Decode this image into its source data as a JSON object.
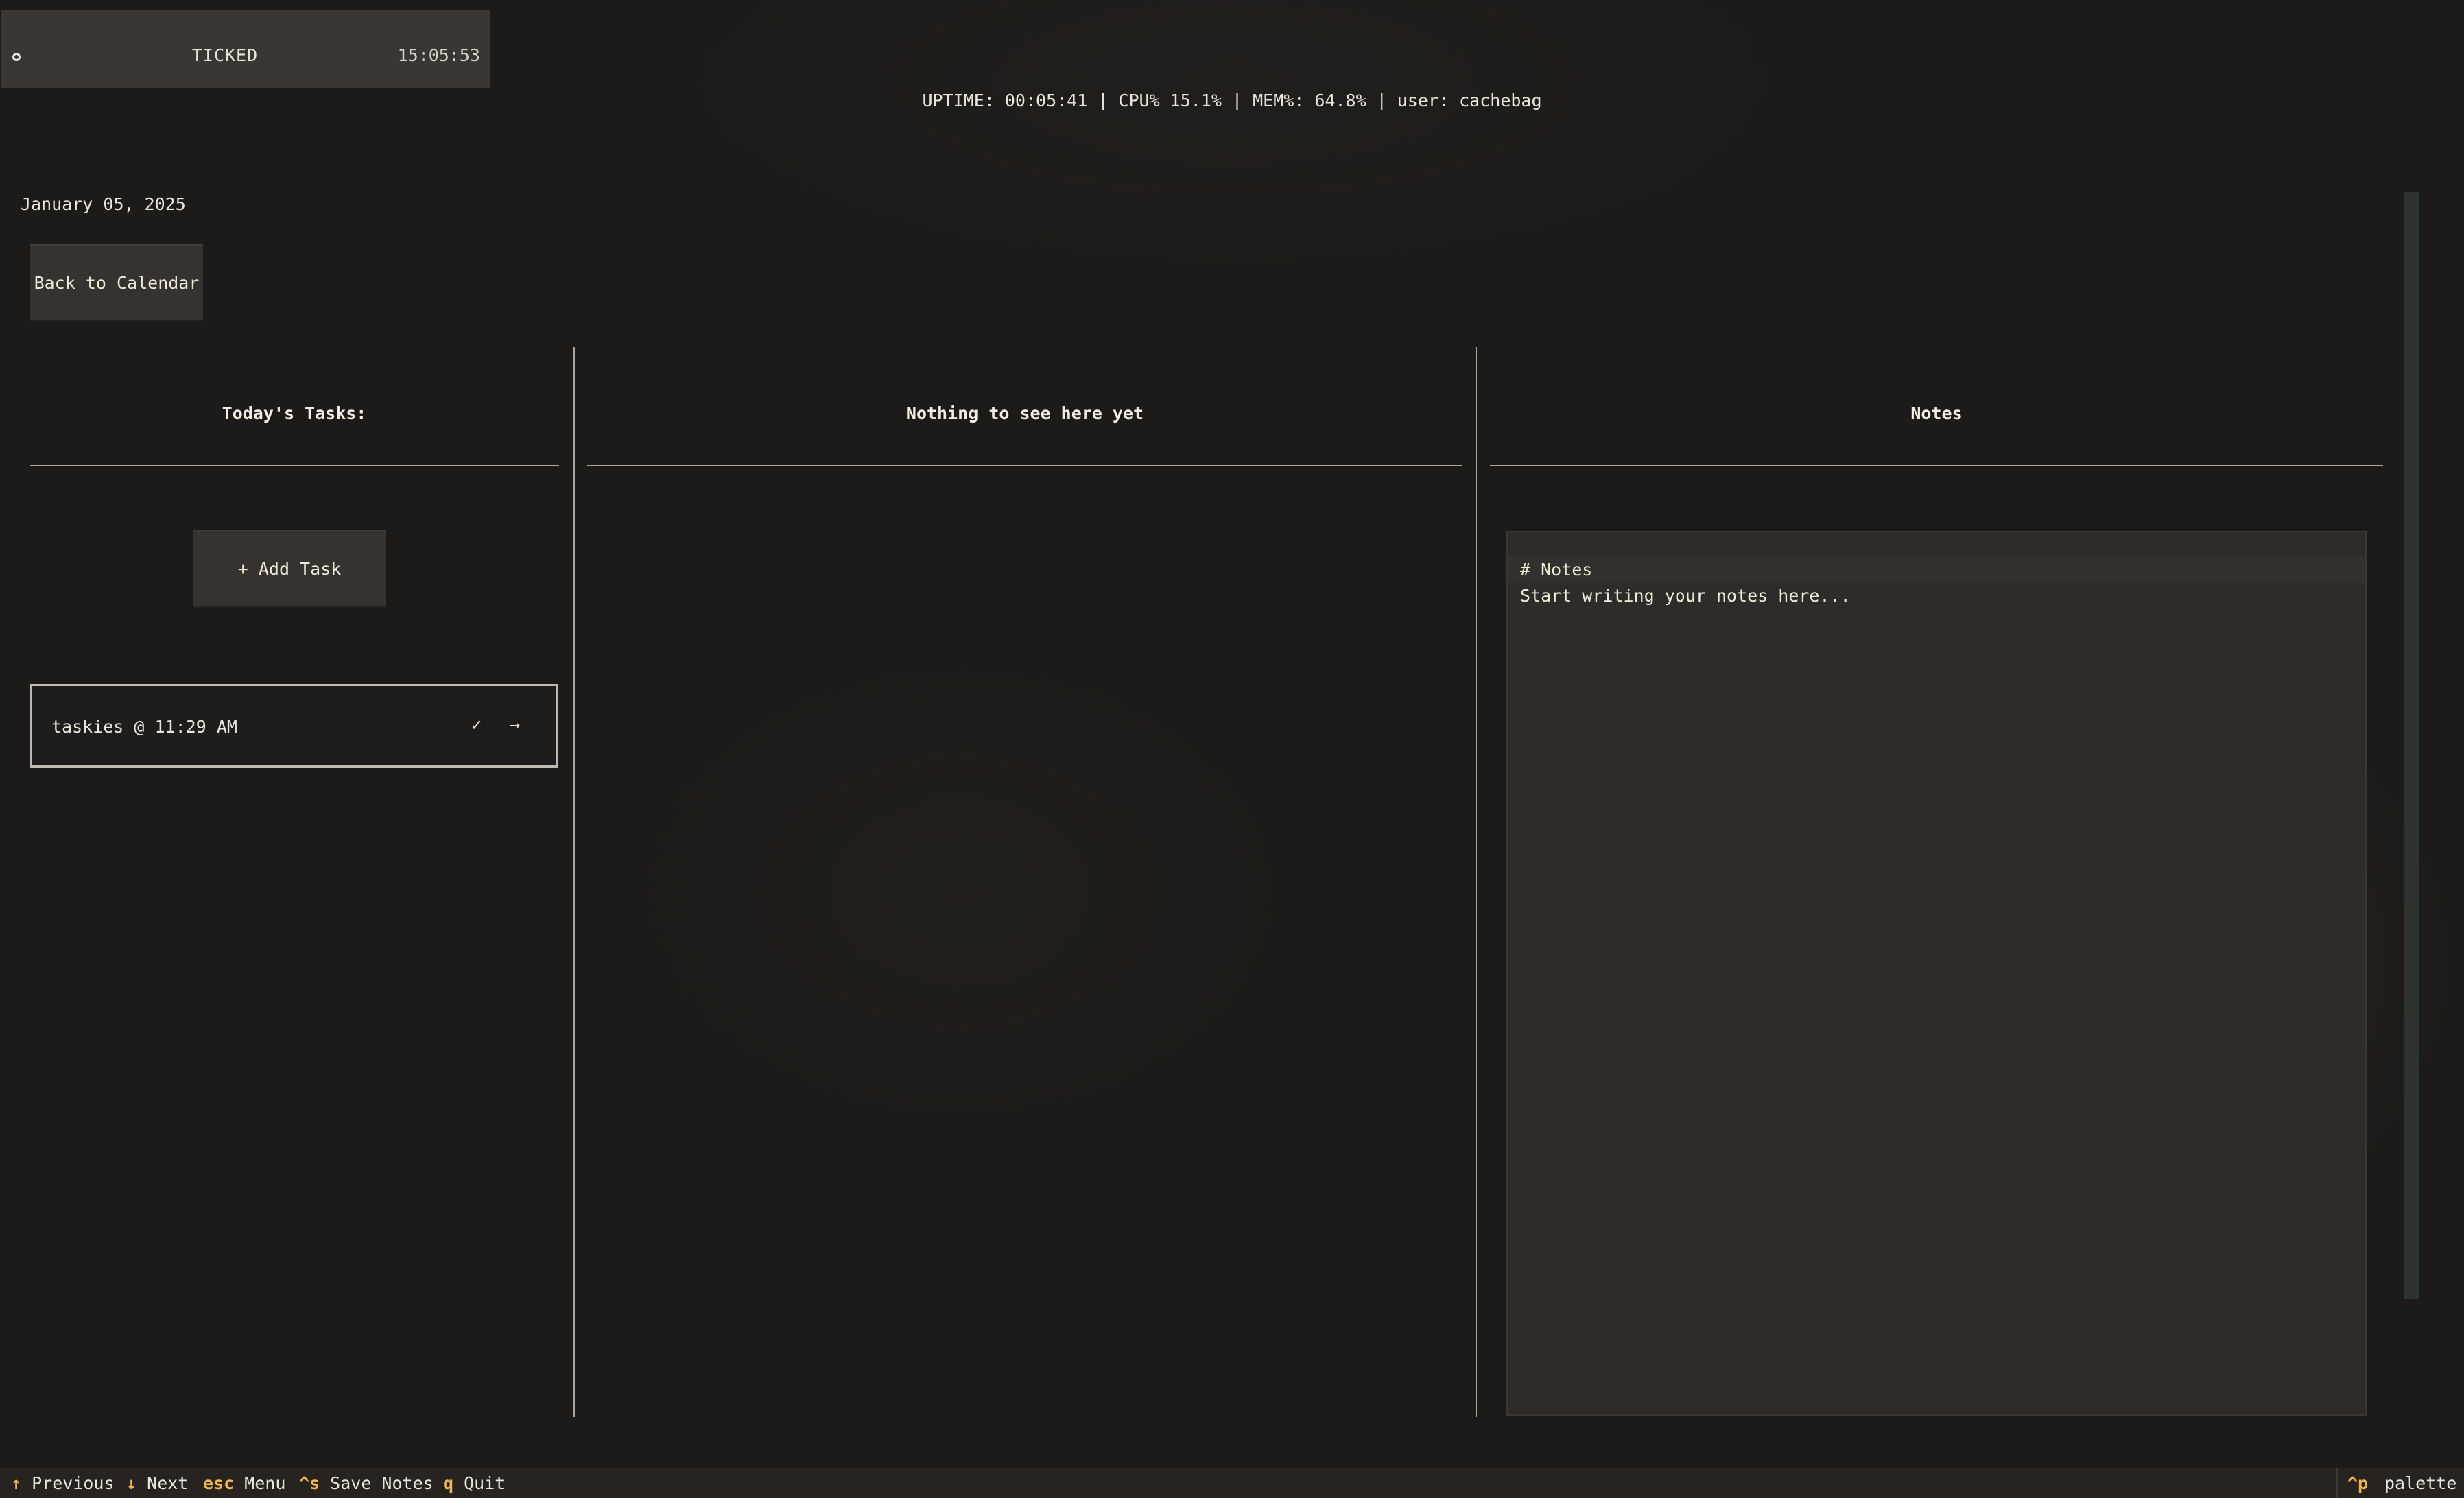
{
  "header": {
    "title": "TICKED",
    "clock": "15:05:53",
    "status_icon": "circle-icon"
  },
  "sysinfo": "UPTIME: 00:05:41 | CPU% 15.1% | MEM%: 64.8% | user: cachebag",
  "day_view": {
    "date": "January 05, 2025",
    "back_button": "Back to Calendar"
  },
  "tasks": {
    "title": "Today's Tasks:",
    "add_button": "+ Add Task",
    "items": [
      {
        "label": "taskies @ 11:29 AM",
        "done_icon": "✓",
        "move_icon": "→"
      }
    ]
  },
  "middle": {
    "title": "Nothing to see here yet"
  },
  "notes": {
    "title": "Notes",
    "line1": "# Notes",
    "line2": "Start writing your notes here..."
  },
  "footer": {
    "items": [
      {
        "key": "↑",
        "label": "Previous"
      },
      {
        "key": "↓",
        "label": "Next"
      },
      {
        "key": "esc",
        "label": "Menu"
      },
      {
        "key": "^s",
        "label": "Save Notes"
      },
      {
        "key": "q",
        "label": "Quit"
      }
    ],
    "palette": {
      "key": "^p",
      "label": "palette"
    }
  },
  "colors": {
    "background": "#1d1b19",
    "accent_key": "#f2b74a",
    "text": "#e8e4dc",
    "panel": "#36322f"
  }
}
